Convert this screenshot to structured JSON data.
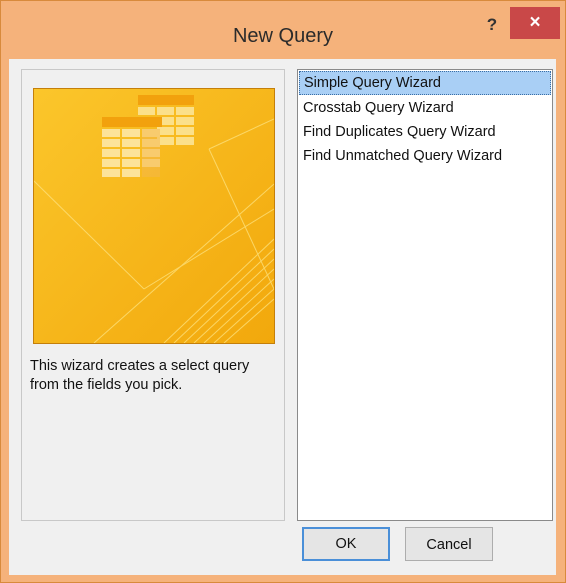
{
  "window": {
    "title": "New Query",
    "help_label": "?",
    "close_label": "×"
  },
  "description": "This wizard creates a select query from the fields you pick.",
  "wizards": [
    {
      "label": "Simple Query Wizard",
      "selected": true
    },
    {
      "label": "Crosstab Query Wizard",
      "selected": false
    },
    {
      "label": "Find Duplicates Query Wizard",
      "selected": false
    },
    {
      "label": "Find Unmatched Query Wizard",
      "selected": false
    }
  ],
  "buttons": {
    "ok_label": "OK",
    "cancel_label": "Cancel"
  },
  "colors": {
    "titlebar": "#f5b27b",
    "close_button": "#c94848",
    "preview_background": "#f6b514",
    "selection": "#a9cff5"
  }
}
